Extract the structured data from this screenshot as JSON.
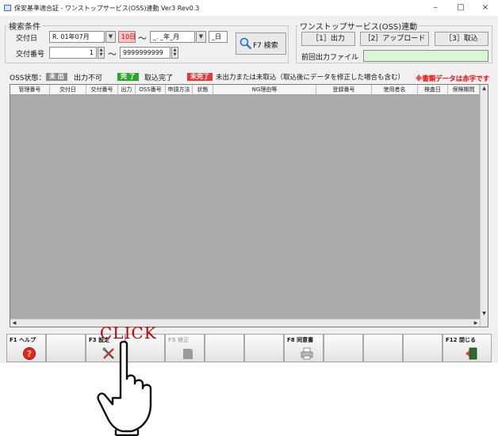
{
  "window": {
    "title": "保安基準適合証 - ワンストップサービス(OSS)連動 Ver3 Rev0.3",
    "minimize": "–",
    "maximize": "□",
    "close": "×"
  },
  "search": {
    "group_label": "検索条件",
    "issue_date_label": "交付日",
    "date_from_value": "R. 01年07月",
    "date_from_day": "10日",
    "range_sep": "～",
    "date_to_value": "_. _年_月",
    "date_to_day": "_日",
    "issue_no_label": "交付番号",
    "no_from_value": "1",
    "no_to_value": "9999999999",
    "search_button": "F7 検索"
  },
  "oss": {
    "group_label": "ワンストップサービス(OSS)連動",
    "output_button": "［1］出力",
    "upload_button": "［2］アップロード",
    "import_button": "［3］取込",
    "last_file_label": "前回出力ファイル",
    "last_file_value": ""
  },
  "status_legend": {
    "label": "OSS状態：",
    "items": [
      {
        "badge": "未 出",
        "text": "出力不可",
        "color": "#8c8c8c"
      },
      {
        "badge": "完 了",
        "text": "取込完了",
        "color": "#2aa52a"
      },
      {
        "badge": "未完了",
        "text": "未出力または未取込（取込後にデータを修正した場合も含む）",
        "color": "#e03c3c"
      }
    ],
    "note": "※書類データは赤字です",
    "note_color": "#ff0000"
  },
  "table": {
    "columns": [
      "管理番号",
      "交付日",
      "交付番号",
      "出力",
      "OSS番号",
      "申請方法",
      "状態",
      "NG理由等",
      "登録番号",
      "使用者名",
      "検査日",
      "保険期間"
    ]
  },
  "fkeys": [
    {
      "label": "F1 ヘルプ",
      "icon": "help-icon",
      "enabled": true
    },
    {
      "label": "",
      "icon": "",
      "enabled": true
    },
    {
      "label": "F3 設定",
      "icon": "settings-tools-icon",
      "enabled": true
    },
    {
      "label": "",
      "icon": "",
      "enabled": true
    },
    {
      "label": "F5 修正",
      "icon": "edit-icon",
      "enabled": false
    },
    {
      "label": "",
      "icon": "",
      "enabled": true
    },
    {
      "label": "",
      "icon": "",
      "enabled": true
    },
    {
      "label": "F8 同意書",
      "icon": "printer-icon",
      "enabled": true
    },
    {
      "label": "",
      "icon": "",
      "enabled": true
    },
    {
      "label": "",
      "icon": "",
      "enabled": true
    },
    {
      "label": "",
      "icon": "",
      "enabled": true
    },
    {
      "label": "F12 閉じる",
      "icon": "exit-door-icon",
      "enabled": true
    }
  ],
  "overlay": {
    "click_text": "CLICK",
    "pointer": "hand-pointer-icon"
  }
}
